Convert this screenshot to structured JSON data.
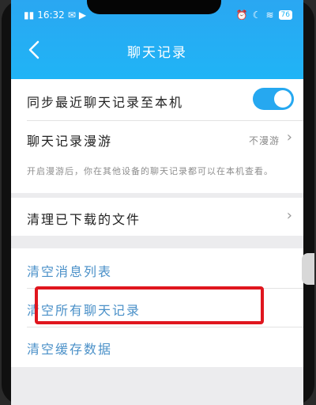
{
  "status": {
    "time": "16:32",
    "battery": "76"
  },
  "nav": {
    "title": "聊天记录"
  },
  "settings": {
    "sync_label": "同步最近聊天记录至本机",
    "sync_enabled": true,
    "roaming_label": "聊天记录漫游",
    "roaming_value": "不漫游",
    "roaming_note": "开启漫游后，你在其他设备的聊天记录都可以在本机查看。",
    "clean_downloads_label": "清理已下载的文件"
  },
  "actions": {
    "clear_messages": "清空消息列表",
    "clear_all_history": "清空所有聊天记录",
    "clear_cache": "清空缓存数据"
  },
  "colors": {
    "header": "#1fb5f6",
    "toggle": "#26a8f0",
    "link": "#4a90c8",
    "highlight": "#e0161e"
  }
}
